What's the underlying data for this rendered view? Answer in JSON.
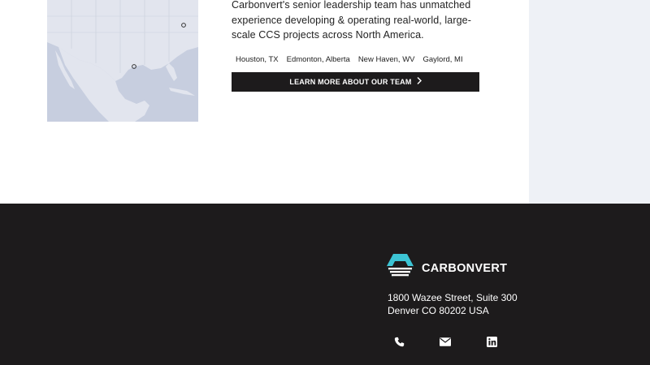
{
  "team": {
    "intro": "Carbonvert's senior leadership team has unmatched experience developing & operating real-world, large-scale CCS projects across North America.",
    "locations": [
      "Houston, TX",
      "Edmonton, Alberta",
      "New Haven, WV",
      "Gaylord, MI"
    ],
    "cta_label": "LEARN MORE ABOUT OUR TEAM",
    "cta_icon": "chevron-right-icon"
  },
  "footer": {
    "brand": "CARBONVERT",
    "address_line1": "1800 Wazee Street, Suite 300",
    "address_line2": "Denver CO 80202 USA",
    "social_icons": [
      "phone-icon",
      "email-icon",
      "linkedin-icon"
    ]
  },
  "colors": {
    "footer_bg": "#1d1b1c",
    "panel_bg": "#eef1f6",
    "logo_teal": "#3cc4d4"
  }
}
